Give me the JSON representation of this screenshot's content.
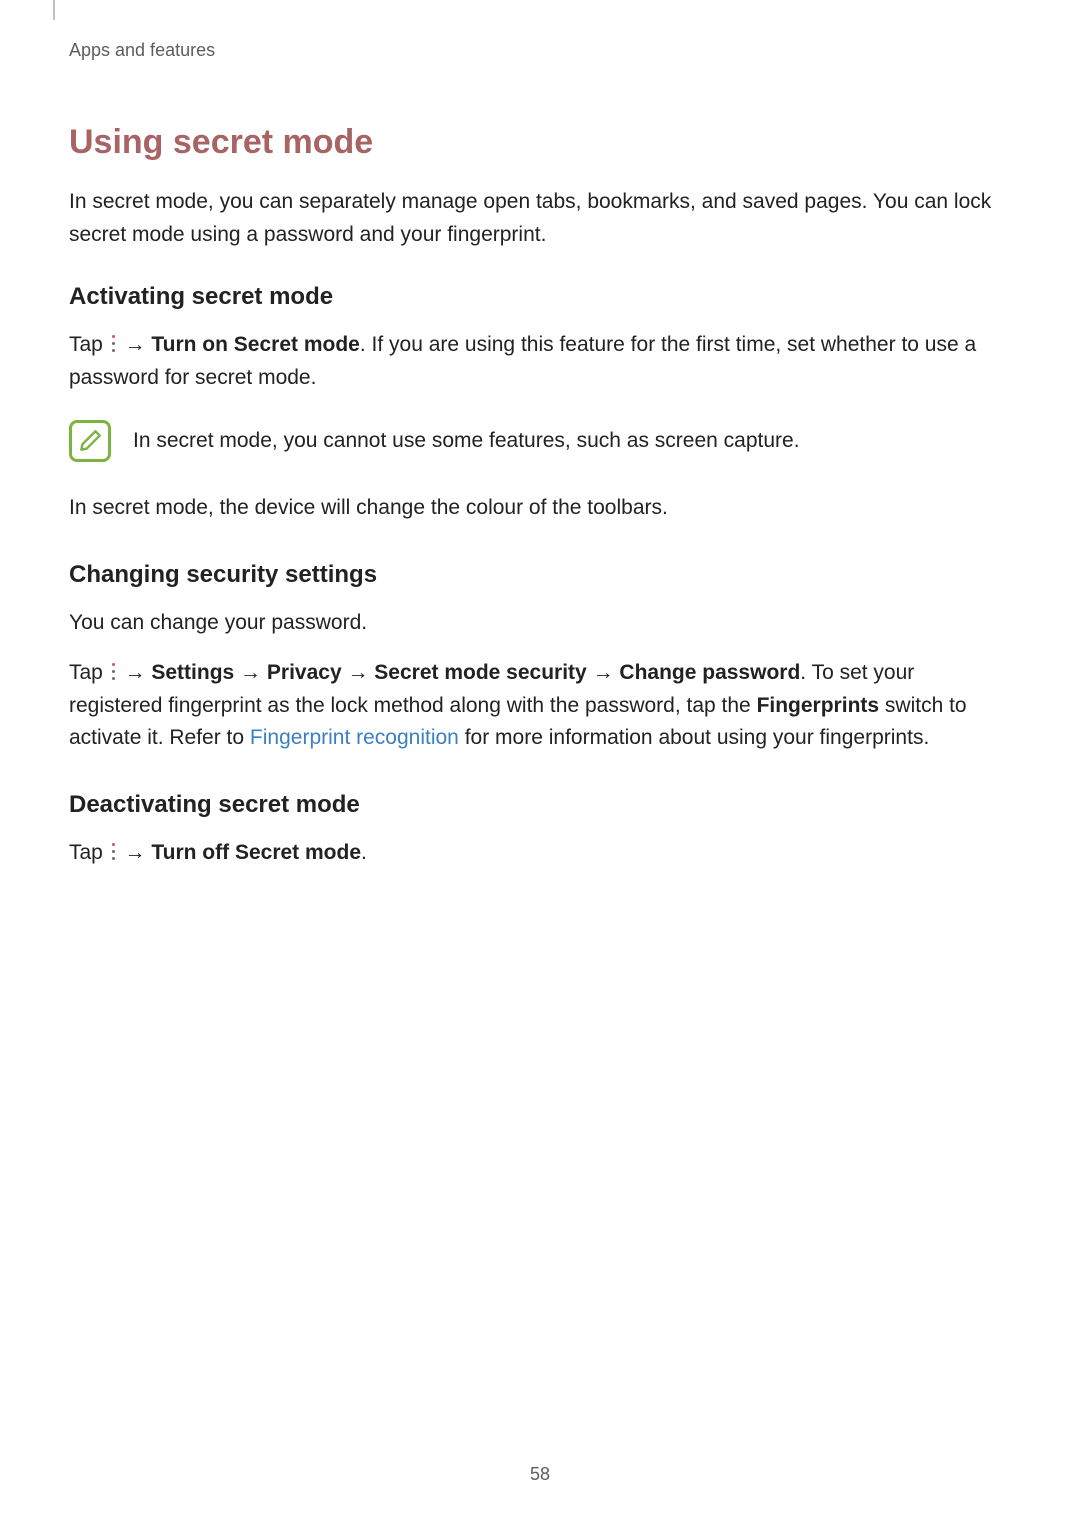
{
  "breadcrumb": "Apps and features",
  "h1": "Using secret mode",
  "intro": "In secret mode, you can separately manage open tabs, bookmarks, and saved pages. You can lock secret mode using a password and your fingerprint.",
  "sections": {
    "activating": {
      "heading": "Activating secret mode",
      "line1_prefix": "Tap ",
      "line1_arrow": " → ",
      "line1_bold": "Turn on Secret mode",
      "line1_suffix": ". If you are using this feature for the first time, set whether to use a password for secret mode.",
      "note": "In secret mode, you cannot use some features, such as screen capture.",
      "after_note": "In secret mode, the device will change the colour of the toolbars."
    },
    "changing": {
      "heading": "Changing security settings",
      "line1": "You can change your password.",
      "line2_prefix": "Tap ",
      "arrow": " → ",
      "settings": "Settings",
      "privacy": "Privacy",
      "sms": "Secret mode security",
      "change_pw": "Change password",
      "line2_mid": ". To set your registered fingerprint as the lock method along with the password, tap the ",
      "fingerprints_bold": "Fingerprints",
      "line2_after_fp": " switch to activate it. Refer to ",
      "link_text": "Fingerprint recognition",
      "line2_end": " for more information about using your fingerprints."
    },
    "deactivating": {
      "heading": "Deactivating secret mode",
      "line1_prefix": "Tap ",
      "arrow": " → ",
      "bold": "Turn off Secret mode",
      "suffix": "."
    }
  },
  "page_number": "58"
}
